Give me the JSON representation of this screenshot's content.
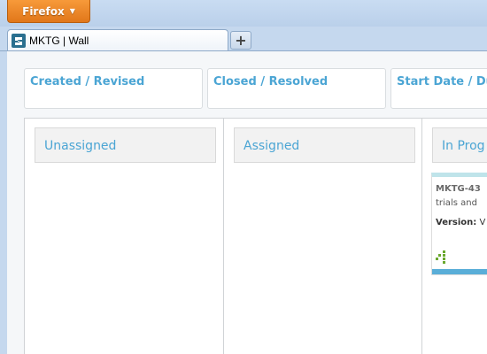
{
  "browser": {
    "menu_button": "Firefox",
    "tab_title": "MKTG | Wall",
    "new_tab": "+"
  },
  "filters": [
    {
      "label": "Created / Revised"
    },
    {
      "label": "Closed / Resolved"
    },
    {
      "label": "Start Date / Du"
    }
  ],
  "lanes": [
    {
      "label": "Unassigned"
    },
    {
      "label": "Assigned"
    },
    {
      "label": "In Prog"
    }
  ],
  "card": {
    "key": "MKTG-43",
    "summary": "trials and",
    "version_label": "Version:",
    "version_value": "V"
  },
  "colors": {
    "accent": "#4ba5d4",
    "card_bar": "#5aaed8",
    "card_top": "#bfe4ea",
    "firefox_orange": "#e87d1e"
  }
}
